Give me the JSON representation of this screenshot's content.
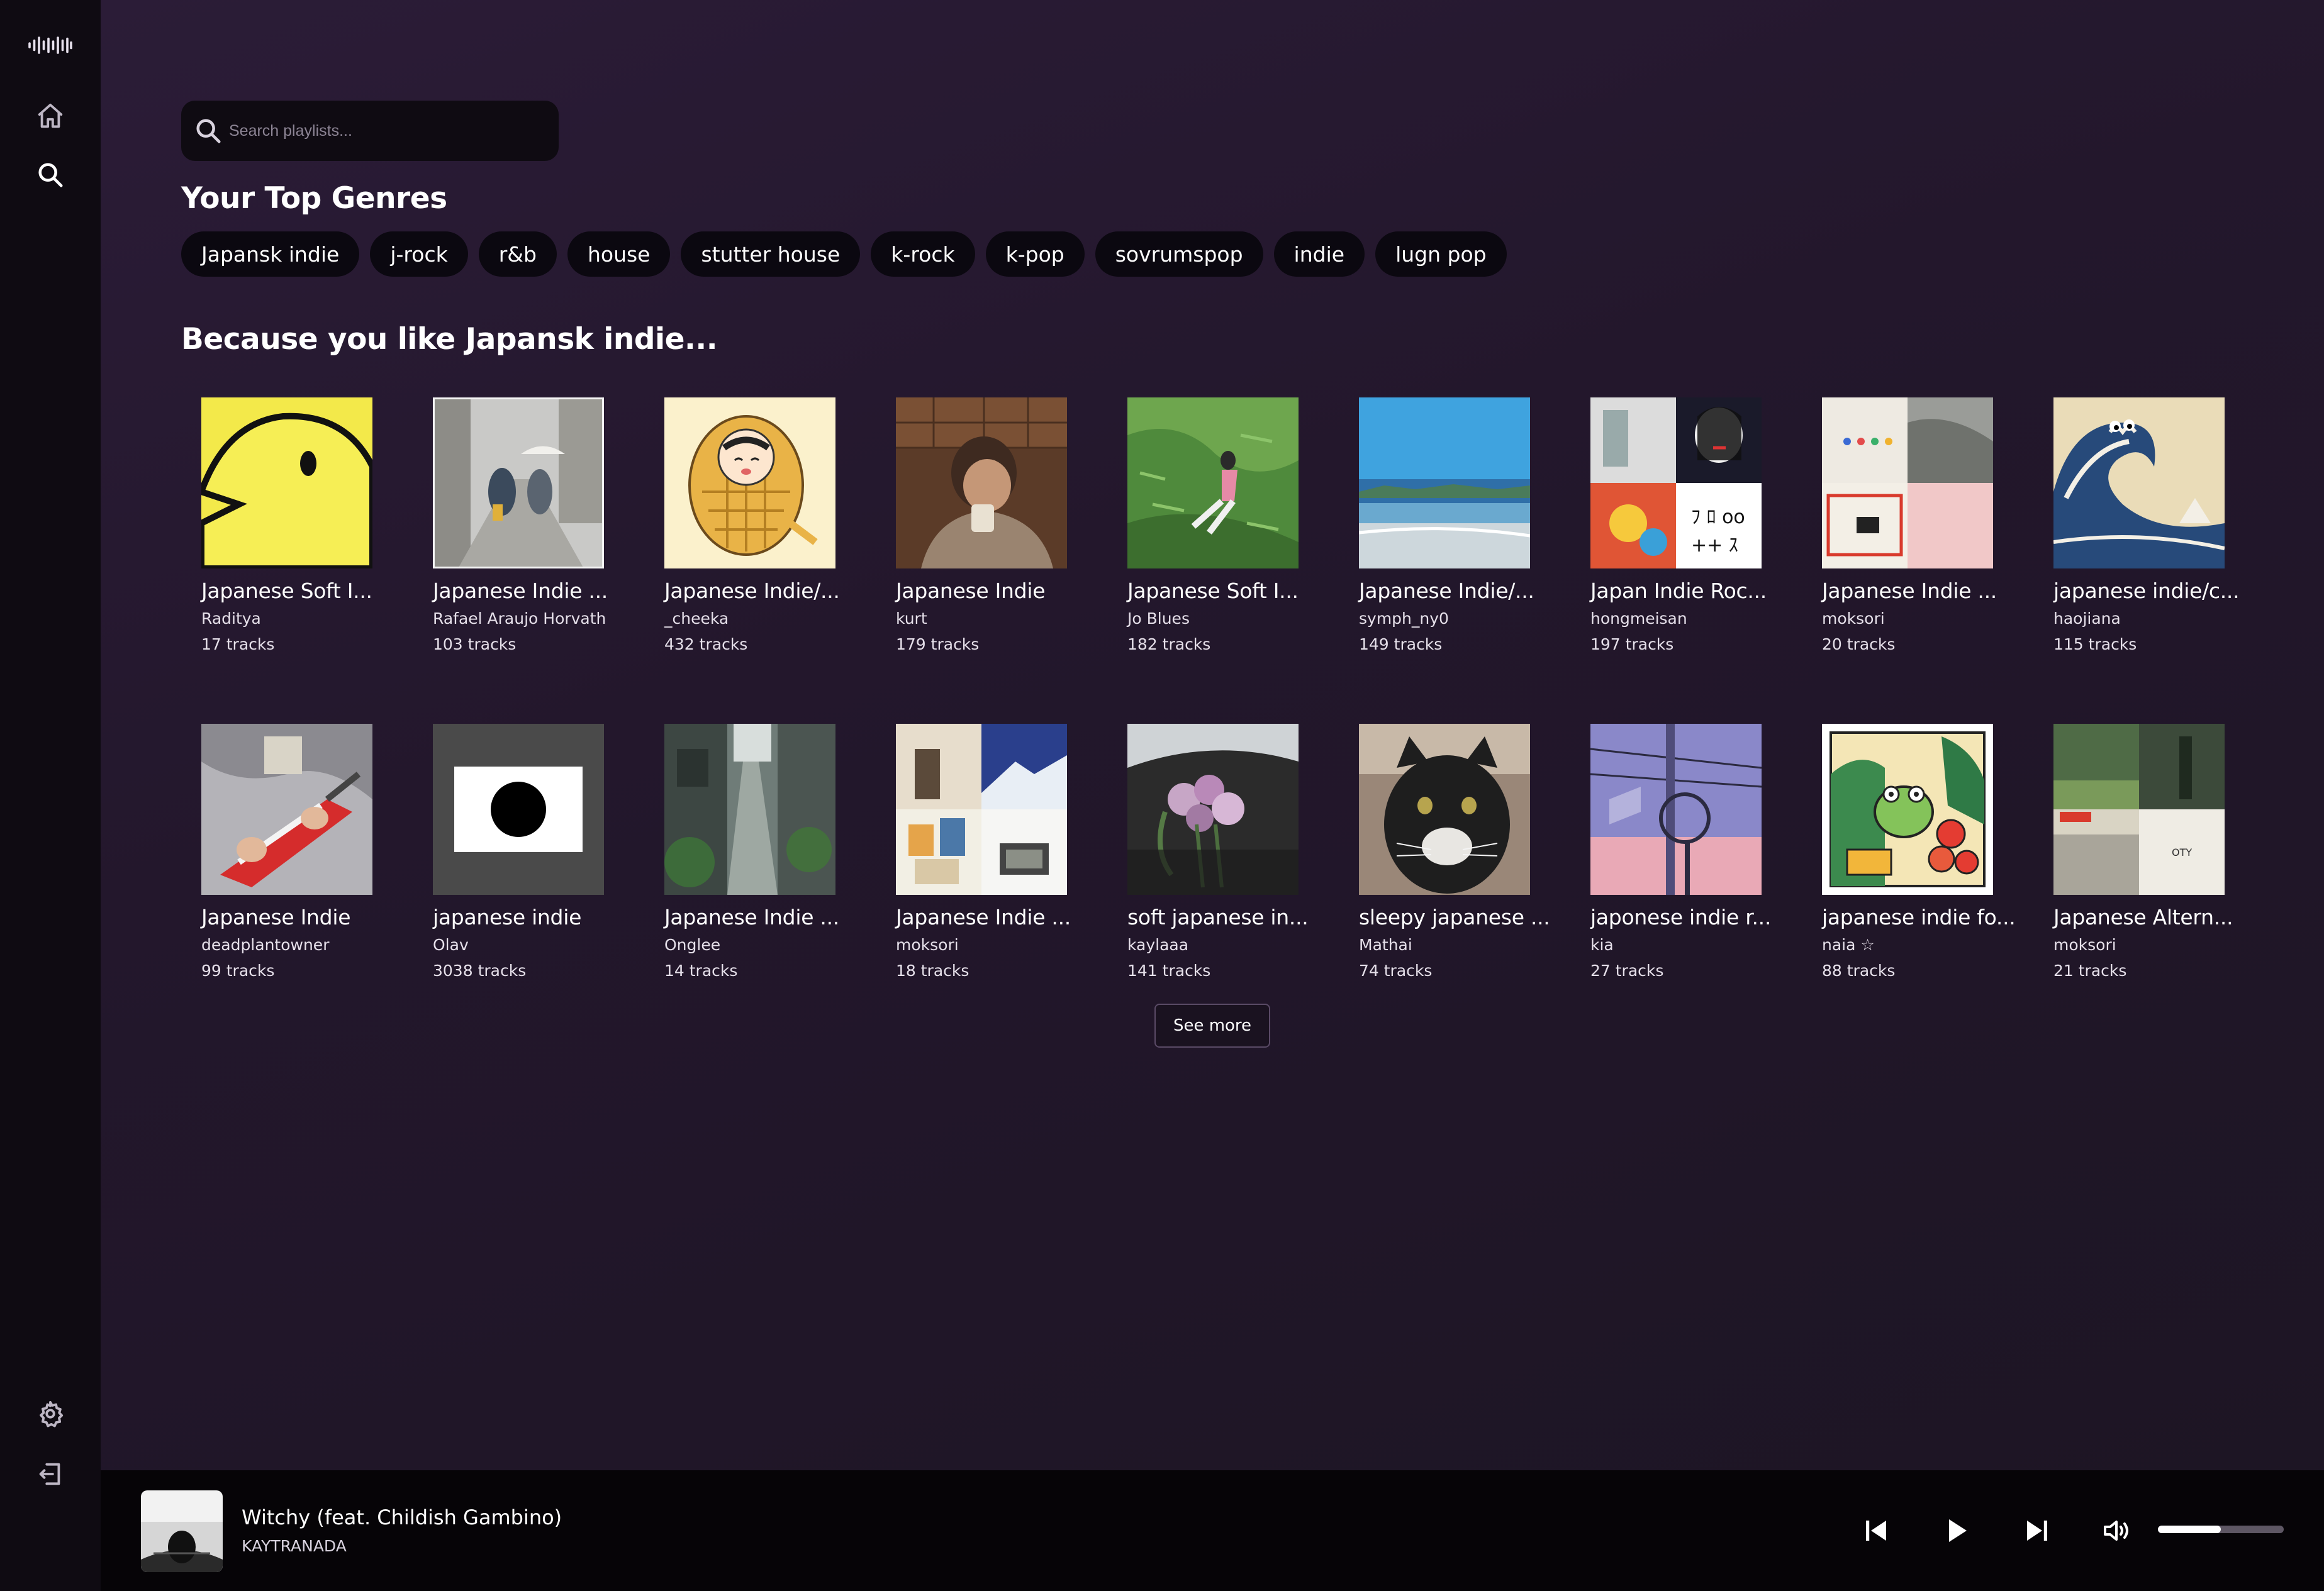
{
  "sidebar": {
    "logo": "soundwave-logo",
    "icons": [
      "home-icon",
      "search-icon",
      "settings-icon",
      "logout-icon"
    ]
  },
  "search": {
    "placeholder": "Search playlists..."
  },
  "top_genres": {
    "heading": "Your Top Genres",
    "items": [
      "Japansk indie",
      "j-rock",
      "r&b",
      "house",
      "stutter house",
      "k-rock",
      "k-pop",
      "sovrumspop",
      "indie",
      "lugn pop"
    ]
  },
  "because": {
    "prefix": "Because you like",
    "genre": "Japansk indie..."
  },
  "playlists": [
    {
      "title": "Japanese Soft I...",
      "owner": "Raditya",
      "tracks": "17 tracks"
    },
    {
      "title": "Japanese Indie ...",
      "owner": "Rafael Araujo Horvath",
      "tracks": "103 tracks"
    },
    {
      "title": "Japanese Indie/...",
      "owner": "_cheeka",
      "tracks": "432 tracks"
    },
    {
      "title": "Japanese Indie",
      "owner": "kurt",
      "tracks": "179 tracks"
    },
    {
      "title": "Japanese Soft I...",
      "owner": "Jo Blues",
      "tracks": "182 tracks"
    },
    {
      "title": "Japanese Indie/...",
      "owner": "symph_ny0",
      "tracks": "149 tracks"
    },
    {
      "title": "Japan Indie Roc...",
      "owner": "hongmeisan",
      "tracks": "197 tracks"
    },
    {
      "title": "Japanese Indie ...",
      "owner": "moksori",
      "tracks": "20 tracks"
    },
    {
      "title": "japanese indie/c...",
      "owner": "haojiana",
      "tracks": "115 tracks"
    },
    {
      "title": "Japanese Indie",
      "owner": "deadplantowner",
      "tracks": "99 tracks"
    },
    {
      "title": "japanese indie",
      "owner": "Olav",
      "tracks": "3038 tracks"
    },
    {
      "title": "Japanese Indie ...",
      "owner": "Onglee",
      "tracks": "14 tracks"
    },
    {
      "title": "Japanese Indie ...",
      "owner": "moksori",
      "tracks": "18 tracks"
    },
    {
      "title": "soft japanese in...",
      "owner": "kaylaaa",
      "tracks": "141 tracks"
    },
    {
      "title": "sleepy japanese ...",
      "owner": "Mathai",
      "tracks": "74 tracks"
    },
    {
      "title": "japonese indie r...",
      "owner": "kia",
      "tracks": "27 tracks"
    },
    {
      "title": "japanese indie fo...",
      "owner": "naia ☆",
      "tracks": "88 tracks"
    },
    {
      "title": "Japanese Altern...",
      "owner": "moksori",
      "tracks": "21 tracks"
    }
  ],
  "see_more": "See more",
  "now_playing": {
    "title": "Witchy (feat. Childish Gambino)",
    "artist": "KAYTRANADA",
    "volume": 0.5
  }
}
